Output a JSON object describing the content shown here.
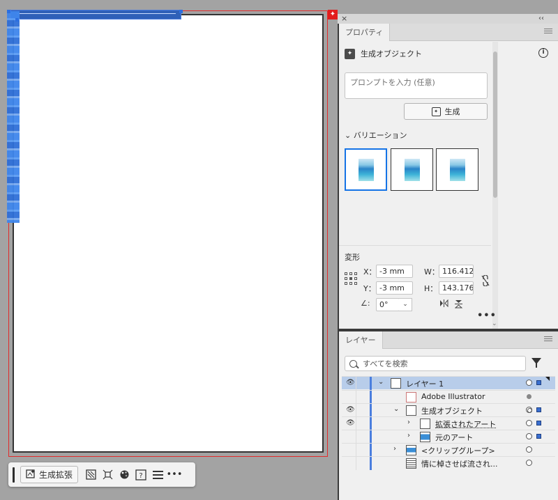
{
  "panel": {
    "close_glyph": "×",
    "collapse_glyph": "‹‹"
  },
  "properties": {
    "tab_label": "プロパティ",
    "section_title": "生成オブジェクト",
    "prompt_placeholder": "プロンプトを入力 (任意)",
    "generate_label": "生成",
    "variations_label": "バリエーション",
    "variation_count": 3,
    "selected_variation": 1,
    "transform": {
      "title": "変形",
      "x_label": "X：",
      "x_value": "-3 mm",
      "y_label": "Y：",
      "y_value": "-3 mm",
      "w_label": "W：",
      "w_value": "116.412",
      "h_label": "H：",
      "h_value": "143.176",
      "angle_value": "0°"
    }
  },
  "layers": {
    "tab_label": "レイヤー",
    "search_placeholder": "すべてを検索",
    "rows": [
      {
        "name": "レイヤー 1",
        "visible": true
      },
      {
        "name": "Adobe  Illustrator",
        "visible": false
      },
      {
        "name": "生成オブジェクト",
        "visible": true
      },
      {
        "name": "拡張されたアート",
        "visible": true
      },
      {
        "name": "元のアート",
        "visible": false
      },
      {
        "name": "<クリップグループ>",
        "visible": false
      },
      {
        "name": "情に棹させば流され...",
        "visible": false
      }
    ]
  },
  "context_toolbar": {
    "expand_label": "生成拡張"
  },
  "colors": {
    "accent": "#1473e6",
    "selection_blue": "#3f86ec",
    "bleed_red": "#e22b2b",
    "layer_color": "#4a7ede"
  }
}
